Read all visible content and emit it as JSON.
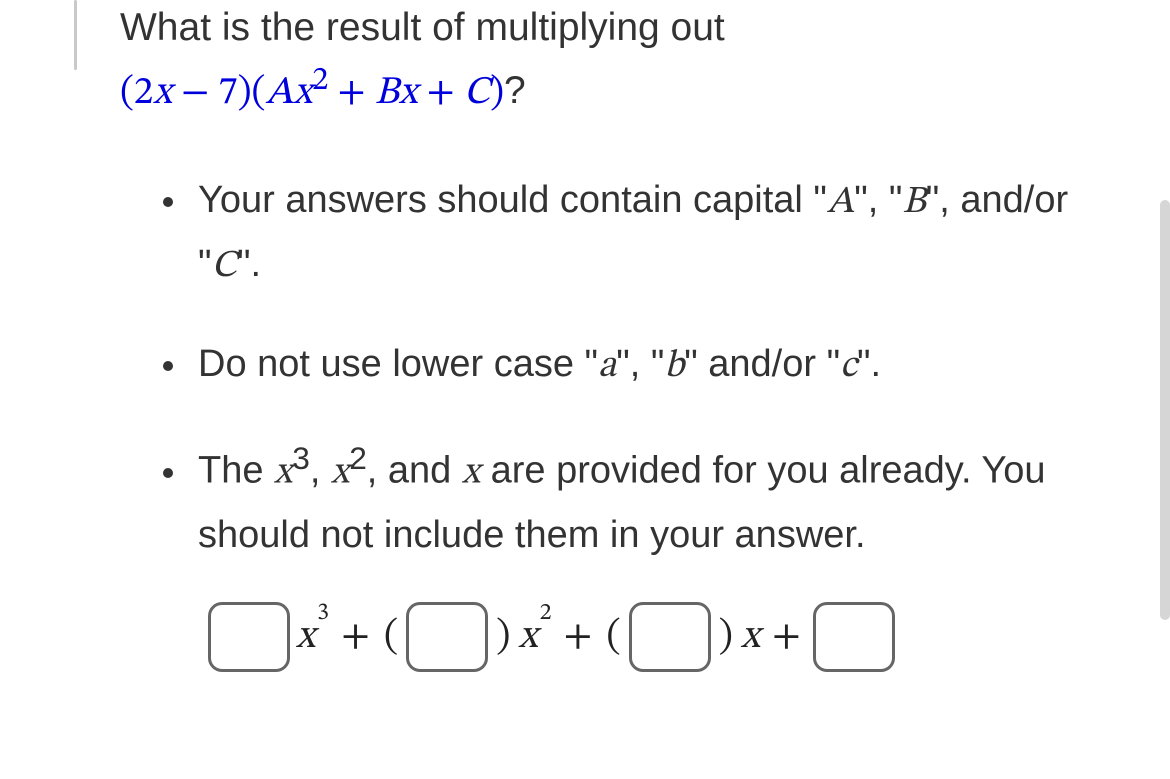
{
  "question": {
    "line1": "What is the result of multiplying out",
    "expr_prefix": "(2",
    "expr_x1": "x",
    "expr_mid1": " − 7)(",
    "expr_A": "A",
    "expr_x2": "x",
    "expr_sup2": "2",
    "expr_plus1": " + ",
    "expr_B": "B",
    "expr_x3": "x",
    "expr_plus2": " + ",
    "expr_C": "C",
    "expr_close": ")",
    "qmark": "?"
  },
  "instructions": {
    "b1": {
      "t1": "Your answers should contain capital \"",
      "A": "A",
      "t2": "\", \"",
      "B": "B",
      "t3": "\", and/or \"",
      "C": "C",
      "t4": "\"."
    },
    "b2": {
      "t1": "Do not use lower case \"",
      "a": "a",
      "t2": "\", \"",
      "b": "b",
      "t3": "\" and/or \"",
      "c": "c",
      "t4": "\"."
    },
    "b3": {
      "t1": "The ",
      "x3_base": "x",
      "x3_sup": "3",
      "comma1": ", ",
      "x2_base": "x",
      "x2_sup": "2",
      "comma2": ", and ",
      "x1": "x",
      "t2": " are provided for you already. You should not include them in your answer."
    }
  },
  "answer": {
    "x3_base": "x",
    "x3_sup": "3",
    "plus": "+",
    "lparen": "(",
    "rparen": ")",
    "x2_base": "x",
    "x2_sup": "2",
    "x1": "x"
  }
}
